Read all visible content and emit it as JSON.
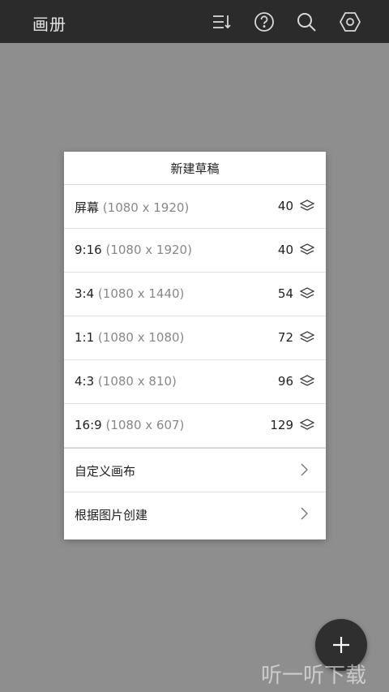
{
  "appbar": {
    "title": "画册",
    "icons": [
      "sort-icon",
      "help-icon",
      "search-icon",
      "settings-icon"
    ]
  },
  "dialog": {
    "title": "新建草稿",
    "presets": [
      {
        "name": "屏幕",
        "dims": "(1080 x 1920)",
        "layers": "40"
      },
      {
        "name": "9:16",
        "dims": "(1080 x 1920)",
        "layers": "40"
      },
      {
        "name": "3:4",
        "dims": "(1080 x 1440)",
        "layers": "54"
      },
      {
        "name": "1:1",
        "dims": "(1080 x 1080)",
        "layers": "72"
      },
      {
        "name": "4:3",
        "dims": "(1080 x 810)",
        "layers": "96"
      },
      {
        "name": "16:9",
        "dims": "(1080 x 607)",
        "layers": "129"
      }
    ],
    "actions": [
      {
        "label": "自定义画布"
      },
      {
        "label": "根据图片创建"
      }
    ]
  },
  "fab": {
    "icon": "plus-icon"
  },
  "watermark": {
    "text": "听一听下载"
  }
}
